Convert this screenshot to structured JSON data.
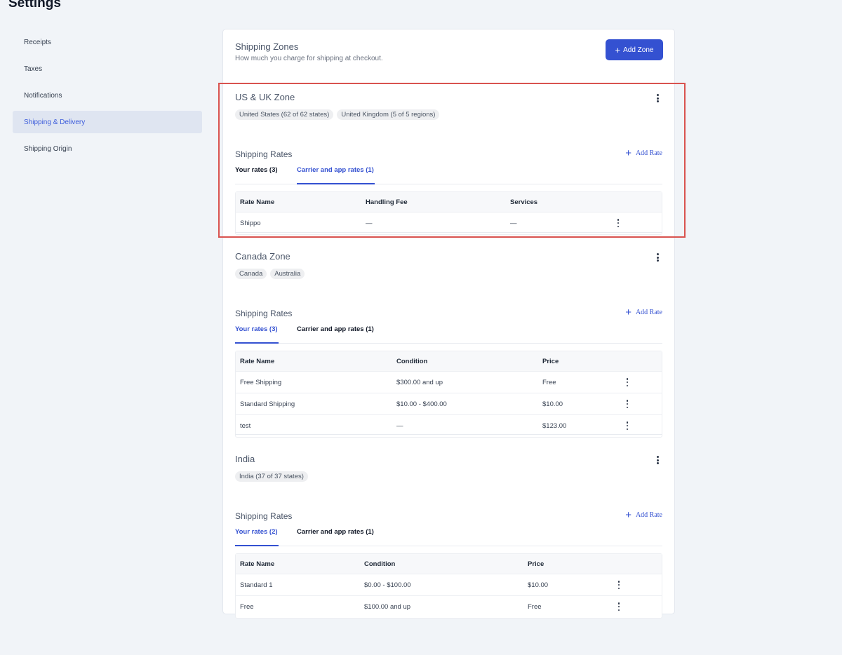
{
  "page": {
    "title": "Settings"
  },
  "sidebar": {
    "items": [
      {
        "label": "Receipts"
      },
      {
        "label": "Taxes"
      },
      {
        "label": "Notifications"
      },
      {
        "label": "Shipping & Delivery",
        "active": true
      },
      {
        "label": "Shipping Origin"
      }
    ]
  },
  "card": {
    "title": "Shipping Zones",
    "subtitle": "How much you charge for shipping at checkout.",
    "add_zone_label": "Add Zone"
  },
  "zones": [
    {
      "name": "US & UK Zone",
      "chips": [
        "United States (62 of 62 states)",
        "United Kingdom (5 of 5 regions)"
      ],
      "rates_title": "Shipping Rates",
      "add_rate_label": "Add Rate",
      "tabs": [
        {
          "label": "Your rates (3)",
          "active": false
        },
        {
          "label": "Carrier and app rates (1)",
          "active": true
        }
      ],
      "columns": [
        "Rate Name",
        "Handling Fee",
        "Services"
      ],
      "rows": [
        [
          "Shippo",
          "—",
          "—"
        ]
      ]
    },
    {
      "name": "Canada Zone",
      "chips": [
        "Canada",
        "Australia"
      ],
      "rates_title": "Shipping Rates",
      "add_rate_label": "Add Rate",
      "tabs": [
        {
          "label": "Your rates (3)",
          "active": true
        },
        {
          "label": "Carrier and app rates (1)",
          "active": false
        }
      ],
      "columns": [
        "Rate Name",
        "Condition",
        "Price"
      ],
      "rows": [
        [
          "Free Shipping",
          "$300.00 and up",
          "Free"
        ],
        [
          "Standard Shipping",
          "$10.00 - $400.00",
          "$10.00"
        ],
        [
          "test",
          "—",
          "$123.00"
        ]
      ]
    },
    {
      "name": "India",
      "chips": [
        "India (37 of 37 states)"
      ],
      "rates_title": "Shipping Rates",
      "add_rate_label": "Add Rate",
      "tabs": [
        {
          "label": "Your rates (2)",
          "active": true
        },
        {
          "label": "Carrier and app rates (1)",
          "active": false
        }
      ],
      "columns": [
        "Rate Name",
        "Condition",
        "Price"
      ],
      "rows": [
        [
          "Standard 1",
          "$0.00 - $100.00",
          "$10.00"
        ],
        [
          "Free",
          "$100.00 and up",
          "Free"
        ]
      ]
    }
  ],
  "colors": {
    "accent": "#3451d1",
    "highlight": "#d9534f",
    "background": "#f1f4f8"
  }
}
